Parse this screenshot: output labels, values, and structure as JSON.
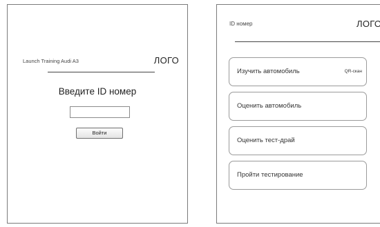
{
  "login": {
    "app_title": "Launch Training Audi A3",
    "logo": "ЛОГО",
    "prompt": "Введите ID номер",
    "id_input_value": "",
    "submit_label": "Войти"
  },
  "menu": {
    "id_label": "ID номер",
    "logo": "ЛОГО",
    "buttons": [
      {
        "label": "Изучить автомобиль",
        "secondary": "QR-скан"
      },
      {
        "label": "Оценить автомобиль"
      },
      {
        "label": "Оценить тест-драй"
      },
      {
        "label": "Пройти тестирование"
      }
    ]
  }
}
